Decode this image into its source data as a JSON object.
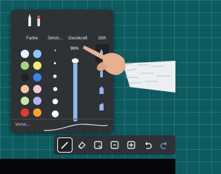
{
  "palette": {
    "headers": {
      "colors": "Farbe",
      "stroke": "Strich...",
      "opacity": "Deckkraft",
      "pen": "Stift"
    },
    "opacity_value": "96%",
    "opacity_fraction": 0.96,
    "preview_label": "Vorsc...",
    "swatches": [
      [
        "#eaf3ff",
        "#8cc6ff"
      ],
      [
        "#a9d37a",
        "#f6e97c"
      ],
      [
        "#202226",
        "#3d82e8"
      ],
      [
        "#f0c7a3",
        "#f4c7d7"
      ],
      [
        "#c6eca3",
        "#b7b3f0"
      ],
      [
        "#e63a2e",
        "#ffa32a"
      ]
    ],
    "accent": "#8fb6e6"
  },
  "toolbar": {
    "tools": [
      {
        "name": "pen-tool-button",
        "icon": "pen-icon",
        "active": true
      },
      {
        "name": "eraser-tool-button",
        "icon": "eraser-icon",
        "active": false
      },
      {
        "name": "select-tool-button",
        "icon": "select-icon",
        "active": false
      },
      {
        "name": "shape-tool-button",
        "icon": "shape-icon",
        "active": false
      },
      {
        "name": "add-tool-button",
        "icon": "add-icon",
        "active": false
      },
      {
        "name": "undo-button",
        "icon": "undo-icon",
        "active": false
      },
      {
        "name": "redo-button",
        "icon": "redo-icon",
        "active": false
      }
    ]
  }
}
